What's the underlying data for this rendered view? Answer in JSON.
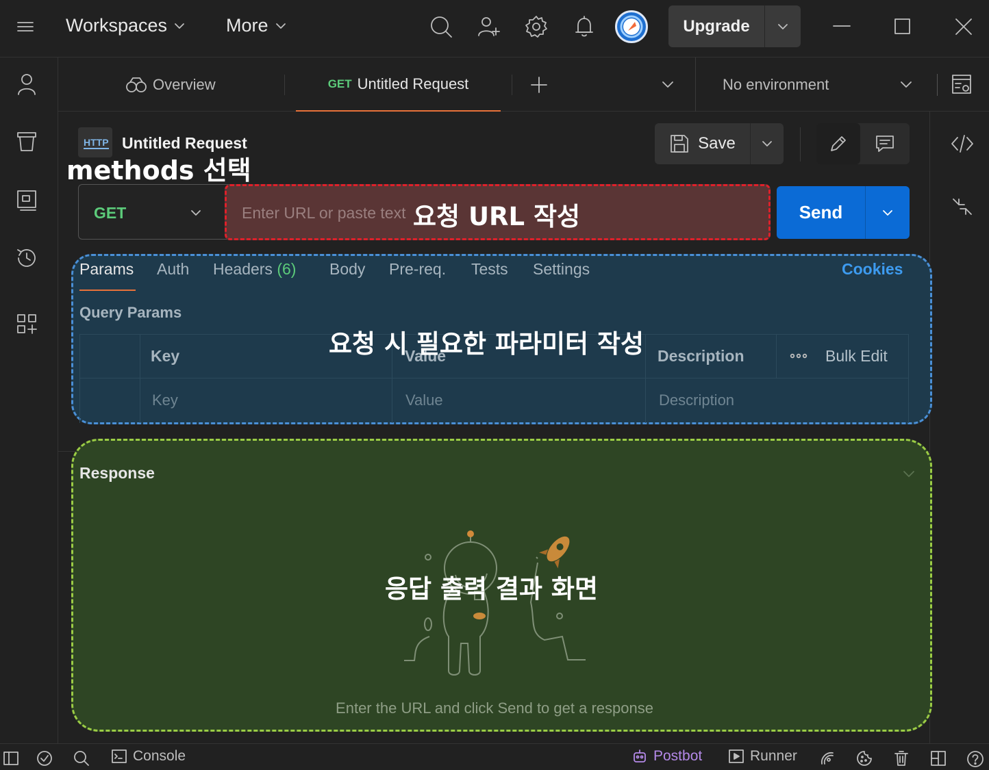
{
  "titlebar": {
    "workspaces_label": "Workspaces",
    "more_label": "More",
    "upgrade_label": "Upgrade",
    "icons": [
      "menu-icon",
      "search-icon",
      "invite-user-icon",
      "settings-icon",
      "notifications-icon",
      "avatar"
    ]
  },
  "tabs": {
    "overview_label": "Overview",
    "active_method": "GET",
    "active_label": "Untitled Request",
    "environment_label": "No environment"
  },
  "request": {
    "title": "Untitled Request",
    "badge": "HTTP",
    "save_label": "Save",
    "method": "GET",
    "url_placeholder": "Enter URL or paste text",
    "send_label": "Send"
  },
  "params": {
    "tabs": [
      {
        "label": "Params"
      },
      {
        "label": "Auth"
      },
      {
        "label": "Headers"
      },
      {
        "label": "Body"
      },
      {
        "label": "Pre-req."
      },
      {
        "label": "Tests"
      },
      {
        "label": "Settings"
      }
    ],
    "headers_count": "(6)",
    "cookies_label": "Cookies",
    "query_params_label": "Query Params",
    "columns": {
      "key": "Key",
      "value": "Value",
      "description": "Description",
      "bulk_edit": "Bulk Edit"
    },
    "placeholders": {
      "key": "Key",
      "value": "Value",
      "description": "Description"
    }
  },
  "response": {
    "title": "Response",
    "hint": "Enter the URL and click Send to get a response"
  },
  "statusbar": {
    "console_label": "Console",
    "postbot_label": "Postbot",
    "runner_label": "Runner"
  },
  "annotations": {
    "methods": "methods 선택",
    "url": "요청 URL 작성",
    "params": "요청 시 필요한 파라미터 작성",
    "response": "응답 출력 결과 화면"
  },
  "colors": {
    "accent_blue": "#0b6bd6",
    "method_get": "#5ccb7a",
    "tab_underline": "#e8723a",
    "url_annotation_border": "#e0202a",
    "params_annotation_border": "#4a8fd6",
    "response_annotation_border": "#9bcc45"
  }
}
